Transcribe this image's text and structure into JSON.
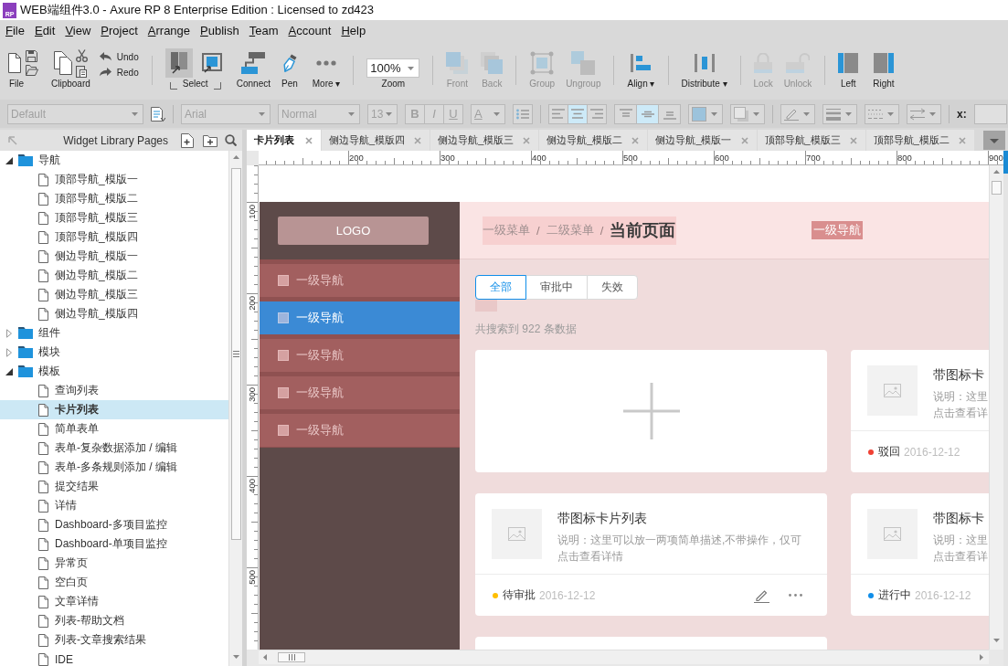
{
  "window": {
    "icon_text": "RP",
    "title": "WEB端组件3.0 - Axure RP 8 Enterprise Edition : Licensed to zd423"
  },
  "menu": [
    "File",
    "Edit",
    "View",
    "Project",
    "Arrange",
    "Publish",
    "Team",
    "Account",
    "Help"
  ],
  "toolbar": [
    [
      {
        "kind": "file",
        "label": "File",
        "disabled": false
      },
      {
        "kind": "clipboard",
        "label": "Clipboard",
        "disabled": false
      },
      {
        "kind": "history",
        "items": [
          {
            "label": "Undo",
            "disabled": false
          },
          {
            "label": "Redo",
            "disabled": false
          }
        ]
      }
    ],
    [
      {
        "kind": "select",
        "label": "Select",
        "disabled": false,
        "modes": [
          {
            "selected": true
          },
          {
            "selected": false
          }
        ]
      },
      {
        "kind": "connect",
        "label": "Connect",
        "disabled": false
      },
      {
        "kind": "pen",
        "label": "Pen",
        "disabled": false
      },
      {
        "kind": "more",
        "label": "More ▾",
        "disabled": false
      }
    ],
    [
      {
        "kind": "zoom",
        "label": "Zoom",
        "value": "100%",
        "disabled": false
      }
    ],
    [
      {
        "kind": "front",
        "label": "Front",
        "disabled": true
      },
      {
        "kind": "back",
        "label": "Back",
        "disabled": true
      }
    ],
    [
      {
        "kind": "group",
        "label": "Group",
        "disabled": true
      },
      {
        "kind": "ungroup",
        "label": "Ungroup",
        "disabled": true
      }
    ],
    [
      {
        "kind": "align",
        "label": "Align ▾",
        "disabled": false
      }
    ],
    [
      {
        "kind": "distribute",
        "label": "Distribute ▾",
        "disabled": false
      }
    ],
    [
      {
        "kind": "lock",
        "label": "Lock",
        "disabled": true
      },
      {
        "kind": "unlock",
        "label": "Unlock",
        "disabled": true
      }
    ],
    [
      {
        "kind": "left",
        "label": "Left",
        "disabled": false
      },
      {
        "kind": "right",
        "label": "Right",
        "disabled": false
      }
    ]
  ],
  "format_bar": {
    "disabled": true,
    "style": "Default",
    "font": "Arial",
    "weight": "Normal",
    "size": "13",
    "text_styles": [
      "B",
      "I",
      "U"
    ],
    "text_color": "A",
    "h_align": [
      {
        "selected": false
      },
      {
        "selected": true
      },
      {
        "selected": false
      }
    ],
    "v_align": [
      {
        "selected": false
      },
      {
        "selected": true
      },
      {
        "selected": false
      }
    ],
    "x_label": "x:"
  },
  "left_panel": {
    "title": "Widget Library Pages",
    "tree": [
      {
        "kind": "folder",
        "label": "导航",
        "expanded": true,
        "selected": false,
        "children": [
          {
            "kind": "page",
            "label": "顶部导航_模版一",
            "selected": false
          },
          {
            "kind": "page",
            "label": "顶部导航_模版二",
            "selected": false
          },
          {
            "kind": "page",
            "label": "顶部导航_模版三",
            "selected": false
          },
          {
            "kind": "page",
            "label": "顶部导航_模版四",
            "selected": false
          },
          {
            "kind": "page",
            "label": "侧边导航_模版一",
            "selected": false
          },
          {
            "kind": "page",
            "label": "侧边导航_模版二",
            "selected": false
          },
          {
            "kind": "page",
            "label": "侧边导航_模版三",
            "selected": false
          },
          {
            "kind": "page",
            "label": "侧边导航_模版四",
            "selected": false
          }
        ]
      },
      {
        "kind": "folder",
        "label": "组件",
        "expanded": false,
        "selected": false
      },
      {
        "kind": "folder",
        "label": "模块",
        "expanded": false,
        "selected": false
      },
      {
        "kind": "folder",
        "label": "模板",
        "expanded": true,
        "selected": false,
        "children": [
          {
            "kind": "page",
            "label": "查询列表",
            "selected": false
          },
          {
            "kind": "page",
            "label": "卡片列表",
            "selected": true
          },
          {
            "kind": "page",
            "label": "简单表单",
            "selected": false
          },
          {
            "kind": "page",
            "label": "表单-复杂数据添加 / 编辑",
            "selected": false
          },
          {
            "kind": "page",
            "label": "表单-多条规则添加 / 编辑",
            "selected": false
          },
          {
            "kind": "page",
            "label": "提交结果",
            "selected": false
          },
          {
            "kind": "page",
            "label": "详情",
            "selected": false
          },
          {
            "kind": "page",
            "label": "Dashboard-多项目监控",
            "selected": false
          },
          {
            "kind": "page",
            "label": "Dashboard-单项目监控",
            "selected": false
          },
          {
            "kind": "page",
            "label": "异常页",
            "selected": false
          },
          {
            "kind": "page",
            "label": "空白页",
            "selected": false
          },
          {
            "kind": "page",
            "label": "文章详情",
            "selected": false
          },
          {
            "kind": "page",
            "label": "列表-帮助文档",
            "selected": false
          },
          {
            "kind": "page",
            "label": "列表-文章搜索结果",
            "selected": false
          },
          {
            "kind": "page",
            "label": "IDE",
            "selected": false
          }
        ]
      }
    ]
  },
  "tabs": [
    {
      "label": "卡片列表",
      "selected": true
    },
    {
      "label": "侧边导航_模版四",
      "selected": false
    },
    {
      "label": "侧边导航_模版三",
      "selected": false
    },
    {
      "label": "侧边导航_模版二",
      "selected": false
    },
    {
      "label": "侧边导航_模版一",
      "selected": false
    },
    {
      "label": "顶部导航_模版三",
      "selected": false
    },
    {
      "label": "顶部导航_模版二",
      "selected": false
    }
  ],
  "rulers": {
    "horizontal": [
      "200",
      "300",
      "400",
      "500",
      "600",
      "700",
      "800",
      "900"
    ],
    "vertical": [
      "100",
      "200",
      "300",
      "400",
      "500"
    ]
  },
  "page": {
    "logo": "LOGO",
    "nav": [
      {
        "label": "一级导航",
        "selected": false
      },
      {
        "label": "一级导航",
        "selected": true
      },
      {
        "label": "一级导航",
        "selected": false
      },
      {
        "label": "一级导航",
        "selected": false
      },
      {
        "label": "一级导航",
        "selected": false
      }
    ],
    "breadcrumb": [
      {
        "kind": "link",
        "text": "一级菜单"
      },
      {
        "kind": "separator",
        "text": "/"
      },
      {
        "kind": "link",
        "text": "二级菜单"
      },
      {
        "kind": "separator",
        "text": "/"
      },
      {
        "kind": "current",
        "text": "当前页面"
      }
    ],
    "header_tag": "一级导航",
    "filters": [
      {
        "label": "全部",
        "selected": true
      },
      {
        "label": "审批中",
        "selected": false
      },
      {
        "label": "失效",
        "selected": false
      }
    ],
    "result_count": "共搜索到 922 条数据",
    "cards": [
      {
        "kind": "add"
      },
      {
        "kind": "item",
        "title": "带图标卡",
        "description": [
          "说明：这里",
          "点击查看详"
        ],
        "status": "驳回",
        "color": "#f04134",
        "date": "2016-12-12",
        "actions": false
      },
      {
        "kind": "item",
        "title": "带图标卡片列表",
        "description": [
          "说明：这里可以放一两项简单描述,不带操作，仅可",
          "点击查看详情"
        ],
        "status": "待审批",
        "color": "#ffbf00",
        "date": "2016-12-12",
        "actions": true
      },
      {
        "kind": "item",
        "title": "带图标卡",
        "description": [
          "说明：这里",
          "点击查看详"
        ],
        "status": "进行中",
        "color": "#108ee9",
        "date": "2016-12-12",
        "actions": false
      },
      {
        "kind": "blank"
      }
    ]
  }
}
